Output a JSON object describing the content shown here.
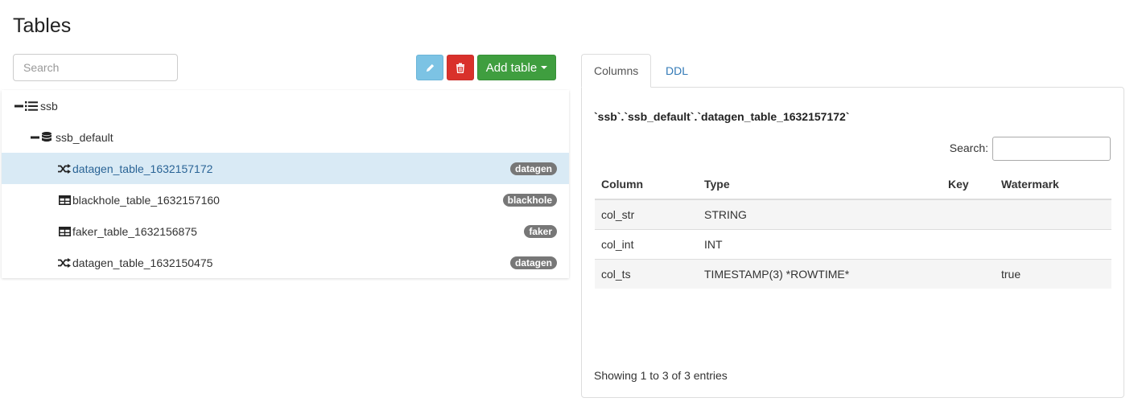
{
  "page": {
    "title": "Tables"
  },
  "toolbar": {
    "search_placeholder": "Search",
    "edit_icon": "pencil-icon",
    "delete_icon": "trash-icon",
    "add_table_label": "Add table"
  },
  "tree": {
    "catalog": {
      "label": "ssb",
      "icon": "list-icon",
      "expand_icon": "minus-icon"
    },
    "database": {
      "label": "ssb_default",
      "icon": "database-icon",
      "expand_icon": "minus-icon"
    },
    "tables": [
      {
        "label": "datagen_table_1632157172",
        "badge": "datagen",
        "icon": "shuffle-icon",
        "selected": true
      },
      {
        "label": "blackhole_table_1632157160",
        "badge": "blackhole",
        "icon": "table-icon",
        "selected": false
      },
      {
        "label": "faker_table_1632156875",
        "badge": "faker",
        "icon": "table-icon",
        "selected": false
      },
      {
        "label": "datagen_table_1632150475",
        "badge": "datagen",
        "icon": "shuffle-icon",
        "selected": false
      }
    ]
  },
  "detail": {
    "tabs": [
      {
        "label": "Columns",
        "active": true
      },
      {
        "label": "DDL",
        "active": false
      }
    ],
    "qualified_name": "`ssb`.`ssb_default`.`datagen_table_1632157172`",
    "search_label": "Search:",
    "search_value": "",
    "headers": [
      "Column",
      "Type",
      "Key",
      "Watermark"
    ],
    "rows": [
      [
        "col_str",
        "STRING",
        "",
        ""
      ],
      [
        "col_int",
        "INT",
        "",
        ""
      ],
      [
        "col_ts",
        "TIMESTAMP(3) *ROWTIME*",
        "",
        "true"
      ]
    ],
    "info": "Showing 1 to 3 of 3 entries"
  },
  "colors": {
    "edit_button": "#7cc3e4",
    "delete_button": "#d9312b",
    "add_button": "#3f9e3f",
    "selected_row": "#d9eaf5",
    "link": "#337ab7",
    "badge": "#777777"
  }
}
